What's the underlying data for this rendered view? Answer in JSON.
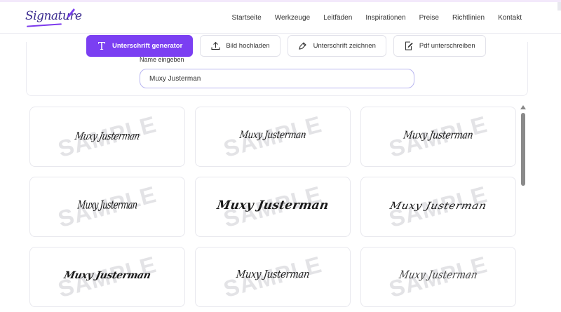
{
  "brand": {
    "name": "Signature",
    "accent": "#7b3ff2"
  },
  "nav": {
    "items": [
      "Startseite",
      "Werkzeuge",
      "Leitfäden",
      "Inspirationen",
      "Preise",
      "Richtlinien",
      "Kontakt"
    ]
  },
  "tabs": [
    {
      "label": "Unterschrift generator",
      "icon": "text-icon",
      "active": true
    },
    {
      "label": "Bild hochladen",
      "icon": "upload-icon",
      "active": false
    },
    {
      "label": "Unterschrift zeichnen",
      "icon": "pen-icon",
      "active": false
    },
    {
      "label": "Pdf unterschreiben",
      "icon": "document-sign-icon",
      "active": false
    }
  ],
  "form": {
    "name_label": "Name eingeben",
    "name_value": "Muxy Justerman"
  },
  "watermark": "SAMPLE",
  "signatures": [
    {
      "text": "Muxy Justerman"
    },
    {
      "text": "Muxy Justerman"
    },
    {
      "text": "Muxy Justerman"
    },
    {
      "text": "Muxy Justerman"
    },
    {
      "text": "Muxy Justerman"
    },
    {
      "text": "Muxy Justerman"
    },
    {
      "text": "Muxy Justerman"
    },
    {
      "text": "Muxy Justerman"
    },
    {
      "text": "Muxy Justerman"
    }
  ]
}
